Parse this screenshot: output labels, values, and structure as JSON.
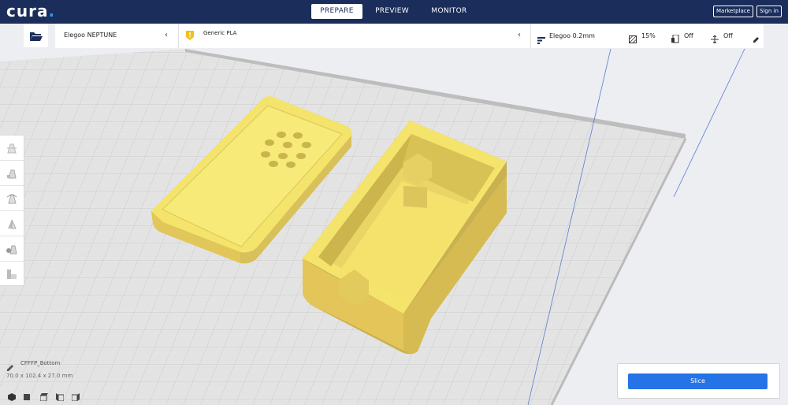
{
  "header": {
    "logo": "cura",
    "logo_dot": ".",
    "tabs": [
      {
        "label": "PREPARE",
        "active": true
      },
      {
        "label": "PREVIEW",
        "active": false
      },
      {
        "label": "MONITOR",
        "active": false
      }
    ],
    "marketplace_label": "Marketplace",
    "signin_label": "Sign in"
  },
  "toolbar": {
    "open_icon": "folder-open-icon",
    "printer_name": "Elegoo NEPTUNE",
    "material_name": "Generic PLA",
    "profile_name": "Elegoo 0.2mm",
    "infill": "15%",
    "support": "Off",
    "adhesion": "Off"
  },
  "tools": [
    "move-tool-icon",
    "scale-tool-icon",
    "rotate-tool-icon",
    "mirror-tool-icon",
    "per-model-settings-icon",
    "support-blocker-icon"
  ],
  "object": {
    "name": "CFFFP_Bottom",
    "dimensions": "70.0 x 102.4 x 27.0 mm"
  },
  "view_buttons": [
    "3d-view-icon",
    "front-view-icon",
    "top-view-icon",
    "left-view-icon",
    "right-view-icon"
  ],
  "slice": {
    "button_label": "Slice"
  },
  "colors": {
    "header_bg": "#1a2d5b",
    "accent_blue": "#2573e6",
    "model_yellow": "#f6e46a",
    "build_plate": "#e2e2e2"
  }
}
